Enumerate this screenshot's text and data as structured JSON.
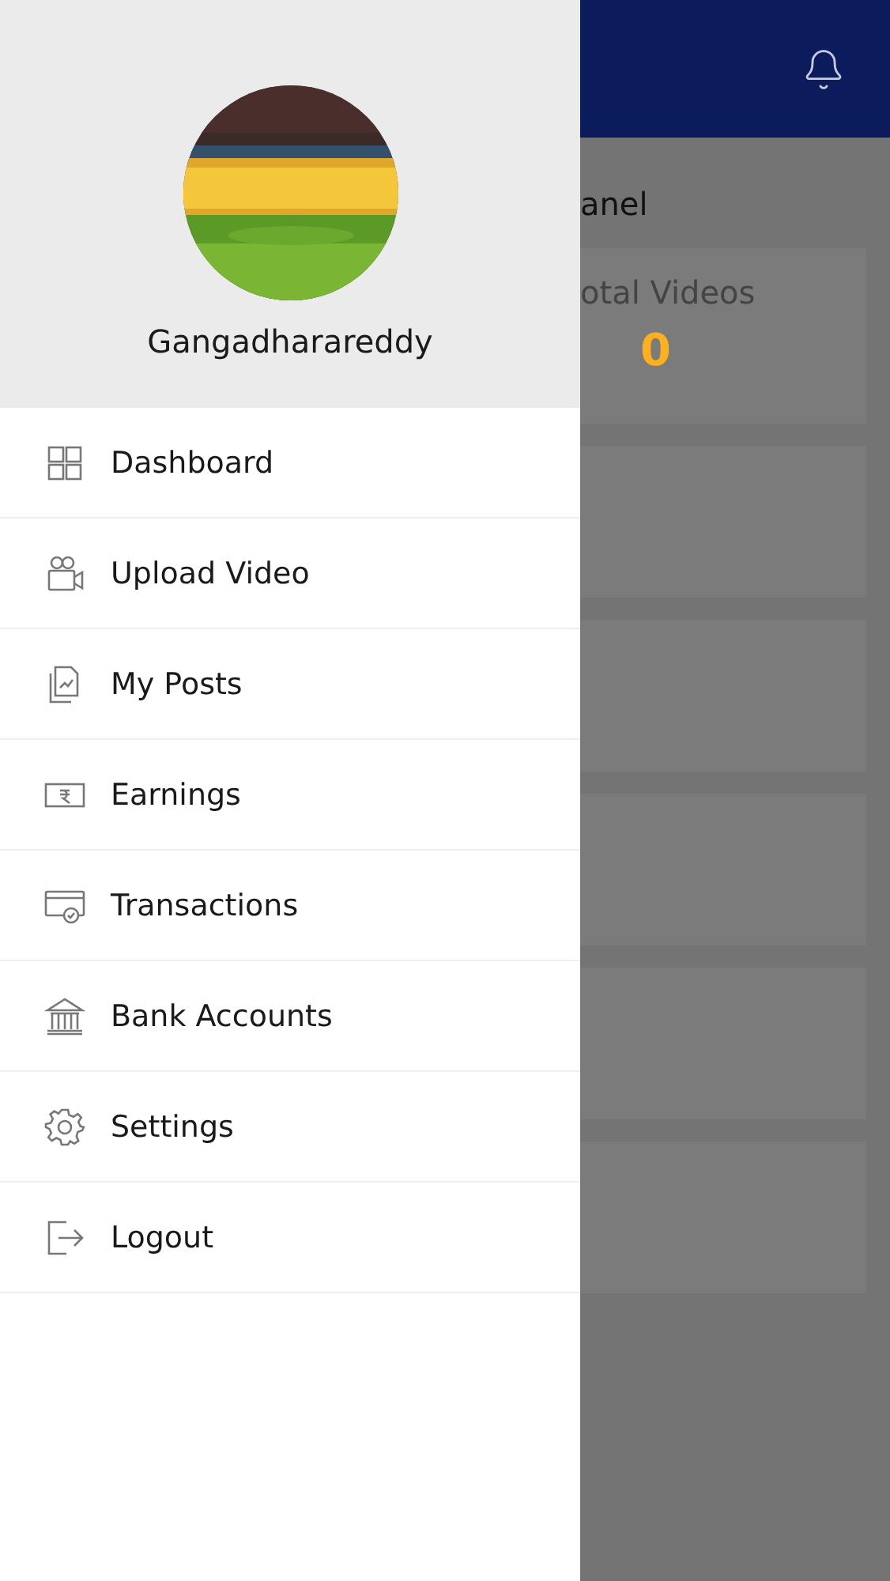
{
  "drawer": {
    "user_name": "Gangadharareddy",
    "items": [
      {
        "label": "Dashboard"
      },
      {
        "label": "Upload Video"
      },
      {
        "label": "My Posts"
      },
      {
        "label": "Earnings"
      },
      {
        "label": "Transactions"
      },
      {
        "label": "Bank Accounts"
      },
      {
        "label": "Settings"
      },
      {
        "label": "Logout"
      }
    ]
  },
  "background": {
    "section_title": "anel",
    "cards": [
      {
        "kind": "stat",
        "title": "otal Videos",
        "value": "0"
      },
      {
        "kind": "blank"
      },
      {
        "kind": "blank"
      },
      {
        "kind": "blank"
      },
      {
        "kind": "blank"
      },
      {
        "kind": "blank"
      }
    ]
  }
}
